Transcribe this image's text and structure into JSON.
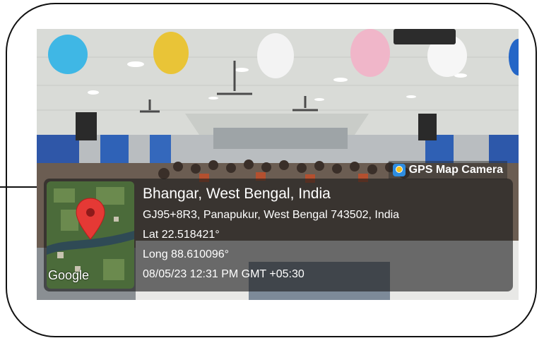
{
  "overlay": {
    "brand": "GPS Map Camera",
    "brand_icon": "map-camera-app-icon",
    "location": "Bhangar, West Bengal, India",
    "address": "GJ95+8R3, Panapukur, West Bengal 743502, India",
    "latitude": "Lat 22.518421°",
    "longitude": "Long 88.610096°",
    "datetime": "08/05/23 12:31 PM GMT +05:30",
    "map_attribution": "Google",
    "map_marker_color": "#e53935"
  }
}
